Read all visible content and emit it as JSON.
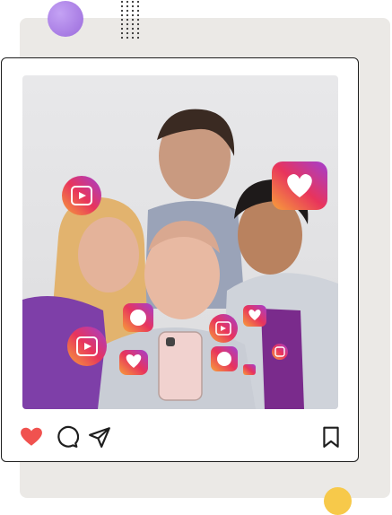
{
  "colors": {
    "background_card": "#ebe9e6",
    "accent_purple": "#9b6bdc",
    "accent_yellow": "#f7c94a",
    "heart_red": "#f0524f",
    "frame_border": "#1e1e1e"
  },
  "post": {
    "photo": {
      "icon": "group-selfie-photo"
    },
    "actions": [
      {
        "icon": "heart-icon",
        "state": "liked"
      },
      {
        "icon": "comment-icon"
      },
      {
        "icon": "share-icon"
      },
      {
        "icon": "bookmark-icon"
      }
    ]
  },
  "floating_icons": [
    "reels-icon",
    "like-notification-icon",
    "comment-notification-icon",
    "camera-icon"
  ]
}
